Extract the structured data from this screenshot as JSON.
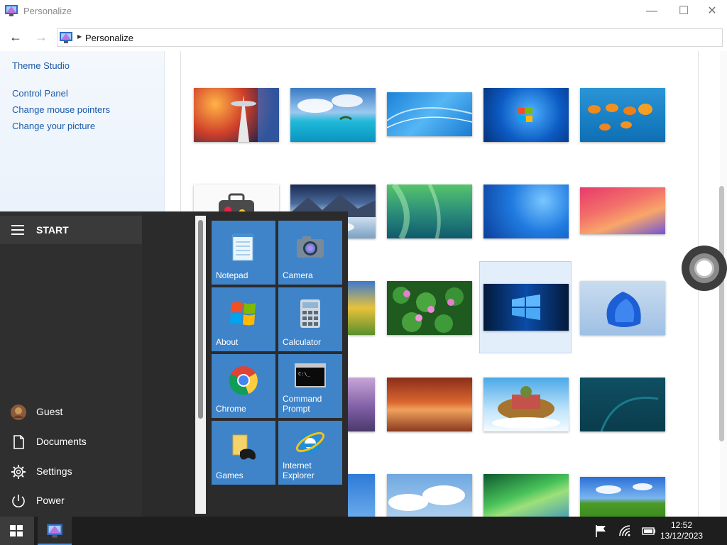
{
  "window": {
    "title": "Personalize",
    "minimize": "—",
    "maximize": "☐",
    "close": "✕"
  },
  "address": {
    "back": "←",
    "forward": "→",
    "breadcrumb": "Personalize"
  },
  "sidebar": {
    "links": [
      "Theme Studio",
      "Control Panel",
      "Change mouse pointers",
      "Change your picture"
    ]
  },
  "content": {
    "partial_heading": "",
    "wallpapers": [
      "space-needle",
      "tropical-island",
      "blue-waves",
      "windows-7",
      "orange-fish",
      "suitcase",
      "mountain-lake",
      "green-aurora",
      "blue-light",
      "macos-big-sur",
      "tulips",
      "water-lilies",
      "windows-10",
      "windows-11-bloom",
      "lavender-field",
      "red-canyon",
      "floating-island",
      "teal-abstract",
      "blue-sky",
      "cloudy-sky",
      "vista-aurora",
      "bliss-hills"
    ],
    "selected": "windows-10"
  },
  "start_menu": {
    "header": "START",
    "items": [
      {
        "label": "Guest",
        "icon": "user-avatar-icon"
      },
      {
        "label": "Documents",
        "icon": "document-icon"
      },
      {
        "label": "Settings",
        "icon": "gear-icon"
      },
      {
        "label": "Power",
        "icon": "power-icon"
      }
    ],
    "tiles": [
      {
        "label": "Notepad",
        "icon": "notepad-icon"
      },
      {
        "label": "Camera",
        "icon": "camera-icon"
      },
      {
        "label": "About",
        "icon": "windows-flag-icon"
      },
      {
        "label": "Calculator",
        "icon": "calculator-icon"
      },
      {
        "label": "Chrome",
        "icon": "chrome-icon"
      },
      {
        "label": "Command Prompt",
        "icon": "command-prompt-icon"
      },
      {
        "label": "Games",
        "icon": "games-icon"
      },
      {
        "label": "Internet Explorer",
        "icon": "internet-explorer-icon"
      }
    ]
  },
  "taskbar": {
    "time": "12:52",
    "date": "13/12/2023"
  },
  "colors": {
    "tile": "#3f84c9",
    "link": "#1a5aa8",
    "start_bg": "#2b2b2b",
    "taskbar_bg": "#1e1e1e"
  }
}
